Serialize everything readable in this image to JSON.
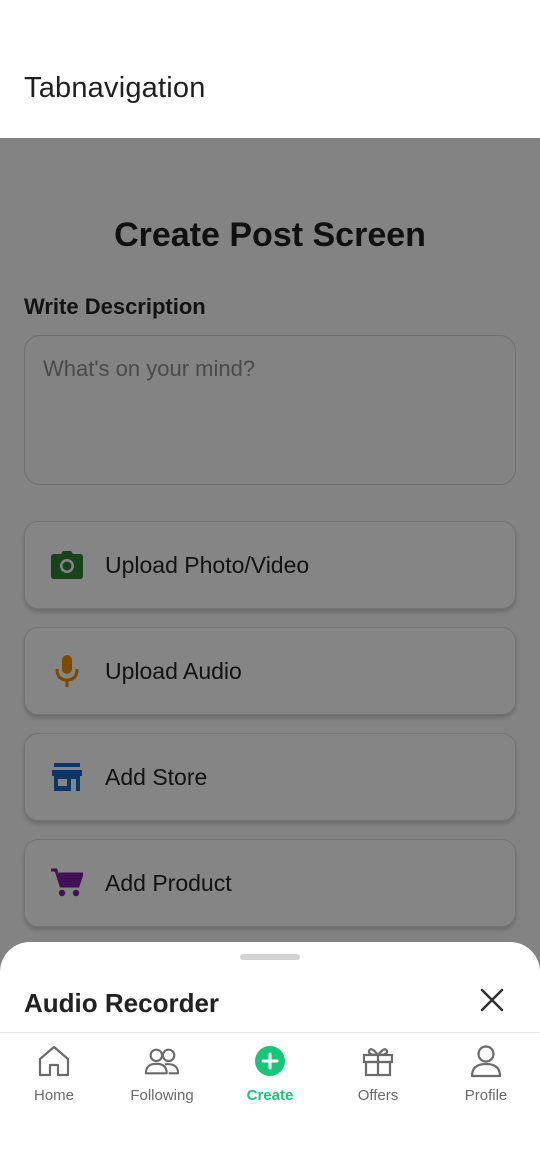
{
  "header": {
    "title": "Tabnavigation"
  },
  "screen": {
    "title": "Create Post Screen",
    "description_label": "Write Description",
    "description_placeholder": "What's on your mind?",
    "actions": [
      {
        "label": "Upload Photo/Video",
        "icon": "camera-icon",
        "color": "#2e7d32"
      },
      {
        "label": "Upload Audio",
        "icon": "microphone-icon",
        "color": "#e68a00"
      },
      {
        "label": "Add Store",
        "icon": "store-icon",
        "color": "#1565c0"
      },
      {
        "label": "Add Product",
        "icon": "cart-icon",
        "color": "#7b1fa2"
      }
    ]
  },
  "sheet": {
    "title": "Audio Recorder",
    "close_icon": "close-icon"
  },
  "tabs": [
    {
      "label": "Home",
      "icon": "home-icon",
      "active": false
    },
    {
      "label": "Following",
      "icon": "people-icon",
      "active": false
    },
    {
      "label": "Create",
      "icon": "plus-circle-icon",
      "active": true
    },
    {
      "label": "Offers",
      "icon": "gift-icon",
      "active": false
    },
    {
      "label": "Profile",
      "icon": "user-icon",
      "active": false
    }
  ],
  "colors": {
    "accent": "#17c67a",
    "overlay": "rgba(0,0,0,0.46)"
  }
}
